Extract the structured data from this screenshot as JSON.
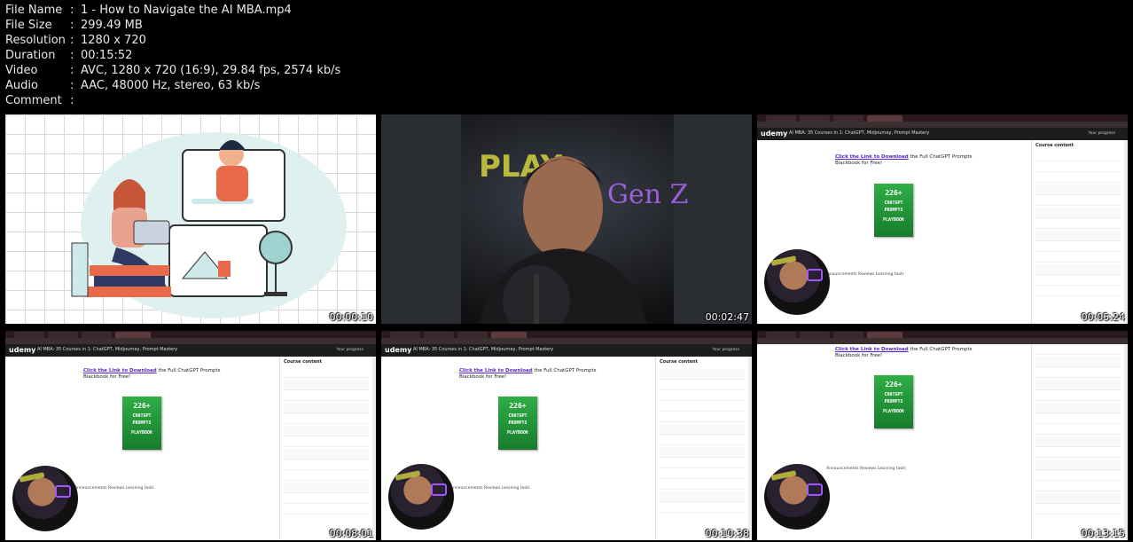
{
  "meta": [
    {
      "key": "File Name",
      "value": "1 - How to Navigate the AI MBA.mp4"
    },
    {
      "key": "File Size",
      "value": "299.49 MB"
    },
    {
      "key": "Resolution",
      "value": "1280 x 720"
    },
    {
      "key": "Duration",
      "value": "00:15:52"
    },
    {
      "key": "Video",
      "value": "AVC, 1280 x 720 (16:9), 29.84 fps, 2574 kb/s"
    },
    {
      "key": "Audio",
      "value": "AAC, 48000 Hz, stereo, 63 kb/s"
    },
    {
      "key": "Comment",
      "value": ""
    }
  ],
  "separator": ":",
  "thumbnails": [
    {
      "timestamp": "00:00:10"
    },
    {
      "timestamp": "00:02:47"
    },
    {
      "timestamp": "00:05:24"
    },
    {
      "timestamp": "00:08:01"
    },
    {
      "timestamp": "00:10:38"
    },
    {
      "timestamp": "00:13:15"
    }
  ],
  "screen": {
    "logo": "udemy",
    "course_title": "AI MBA: 35 Courses in 1: ChatGPT, Midjourney, Prompt Mastery",
    "progress_label": "Your progress",
    "link_text": "Click the Link to Download",
    "link_rest": "the Full ChatGPT Prompts",
    "link_line2": "Blackbook for Free!",
    "book_top": "226+",
    "book_mid1": "CHATGPT",
    "book_mid2": "PROMPTS",
    "book_bottom": "PLAYBOOK",
    "sidebar_title": "Course content",
    "tabs": "Announcements    Reviews    Learning tools"
  },
  "colors": {
    "background": "#000000",
    "text": "#e8e8e8",
    "udemy_bar": "#1c1d1f",
    "book": "#2fae46",
    "link": "#5624d0"
  }
}
